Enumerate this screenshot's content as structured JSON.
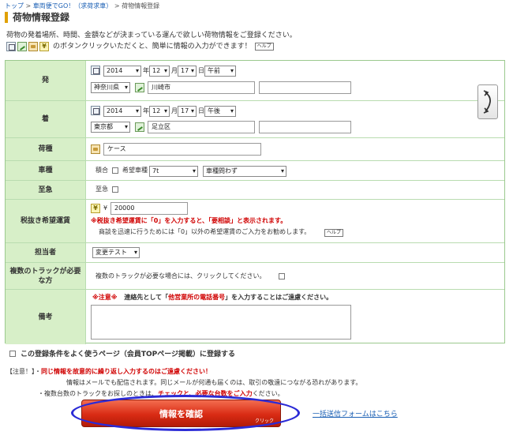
{
  "breadcrumb": {
    "items": [
      {
        "label": "トップ",
        "link": true
      },
      {
        "label": ">",
        "link": false
      },
      {
        "label": "車両便でGO！（求荷求車）",
        "link": true
      },
      {
        "label": ">",
        "link": false
      },
      {
        "label": "荷物情報登録",
        "link": false
      }
    ]
  },
  "page_title": "荷物情報登録",
  "intro": {
    "line1": "荷物の発着場所、時間、金額などが決まっている運んで欲しい荷物情報をご登録ください。",
    "line2": "のボタンクリックいただくと、簡単に情報の入力ができます！",
    "help": "ヘルプ"
  },
  "form": {
    "departure": {
      "label": "発",
      "year": "2014",
      "year_unit": "年",
      "month": "12",
      "month_unit": "月",
      "day": "17",
      "day_unit": "日",
      "ampm": "午前",
      "pref": "神奈川県",
      "city": "川崎市",
      "address": ""
    },
    "arrival": {
      "label": "着",
      "year": "2014",
      "year_unit": "年",
      "month": "12",
      "month_unit": "月",
      "day": "17",
      "day_unit": "日",
      "ampm": "午後",
      "pref": "東京都",
      "city": "足立区",
      "address": ""
    },
    "cargo": {
      "label": "荷種",
      "value": "ケース"
    },
    "vehicle": {
      "label": "車種",
      "mixed_label": "積合",
      "desired_label": "希望車種",
      "size": "7t",
      "type": "車種問わず"
    },
    "urgent": {
      "label": "至急",
      "check_label": "至急"
    },
    "fare": {
      "label": "税抜き希望運賃",
      "yen": "¥",
      "value": "20000",
      "note_red": "※税抜き希望運賃に「0」を入力すると、「要相談」と表示されます。",
      "note": "商談を迅速に行うためには「0」以外の希望運賃のご入力をお勧めします。",
      "help": "ヘルプ"
    },
    "person": {
      "label": "担当者",
      "value": "変更テスト"
    },
    "multi_truck": {
      "label": "複数のトラックが必要な方",
      "text": "複数のトラックが必要な場合には、クリックしてください。"
    },
    "remarks": {
      "label": "備考",
      "warn_prefix": "※注意※",
      "warn_mid": "連絡先として「",
      "warn_red": "他営業所の電話番号",
      "warn_end": "」を入力することはご遠慮ください。"
    }
  },
  "register": {
    "label": "この登録条件をよく使うページ（会員TOPページ掲載）に登録する"
  },
  "notes": {
    "prefix": "【注意！】・",
    "line1_red": "同じ情報を故意的に繰り返し入力するのはご遠慮ください！",
    "line2": "情報はメールでも配信されます。同じメールが何通も届くのは、取引の敬遠につながる恐れがあります。",
    "line3_a": "・複数台数のトラックをお探しのときは、",
    "line3_red": "チェックと、必要な台数をご入力",
    "line3_b": "ください。"
  },
  "confirm": {
    "label": "情報を確認",
    "sub": "クリック"
  },
  "bulk_link": "一括送信フォームはこちら",
  "colors": {
    "accent": "#d92b14",
    "label_bg": "#d7efc8",
    "link": "#1a5fb4",
    "oval": "#2b2bd6"
  }
}
